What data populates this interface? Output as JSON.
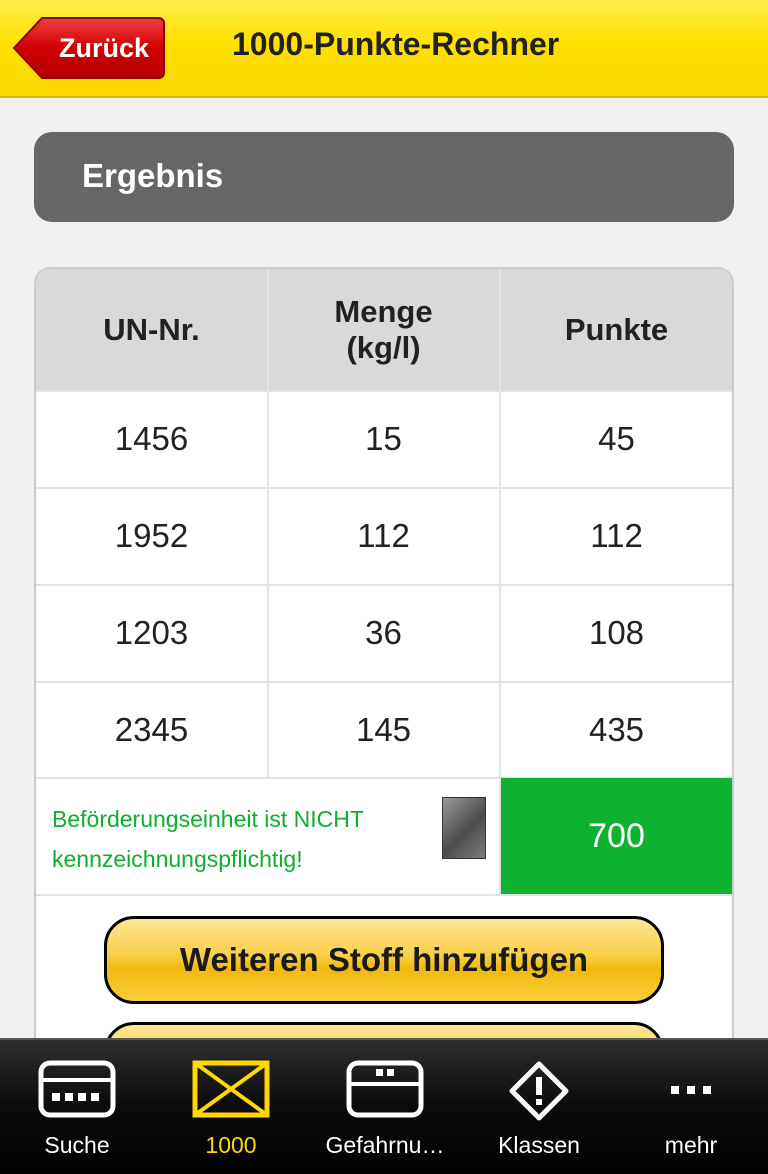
{
  "header": {
    "back_label": "Zurück",
    "title": "1000-Punkte-Rechner"
  },
  "section": {
    "title": "Ergebnis"
  },
  "table": {
    "headers": [
      "UN-Nr.",
      "Menge\n(kg/l)",
      "Punkte"
    ],
    "rows": [
      [
        "1456",
        "15",
        "45"
      ],
      [
        "1952",
        "112",
        "112"
      ],
      [
        "1203",
        "36",
        "108"
      ],
      [
        "2345",
        "145",
        "435"
      ]
    ],
    "result_text": "Beförderungseinheit ist NICHT kennzeichnungspflichtig!",
    "total": "700"
  },
  "actions": {
    "add_label": "Weiteren Stoff hinzufügen"
  },
  "tabbar": {
    "items": [
      {
        "label": "Suche",
        "icon": "search-keyboard-icon"
      },
      {
        "label": "1000",
        "icon": "placard-icon"
      },
      {
        "label": "Gefahrnu…",
        "icon": "hazard-number-icon"
      },
      {
        "label": "Klassen",
        "icon": "warning-diamond-icon"
      },
      {
        "label": "mehr",
        "icon": "more-icon"
      }
    ],
    "active_index": 1
  },
  "colors": {
    "header_yellow": "#ffe000",
    "back_red": "#d40000",
    "section_gray": "#666666",
    "ok_green": "#0cb230",
    "active_tab": "#ffd800"
  }
}
